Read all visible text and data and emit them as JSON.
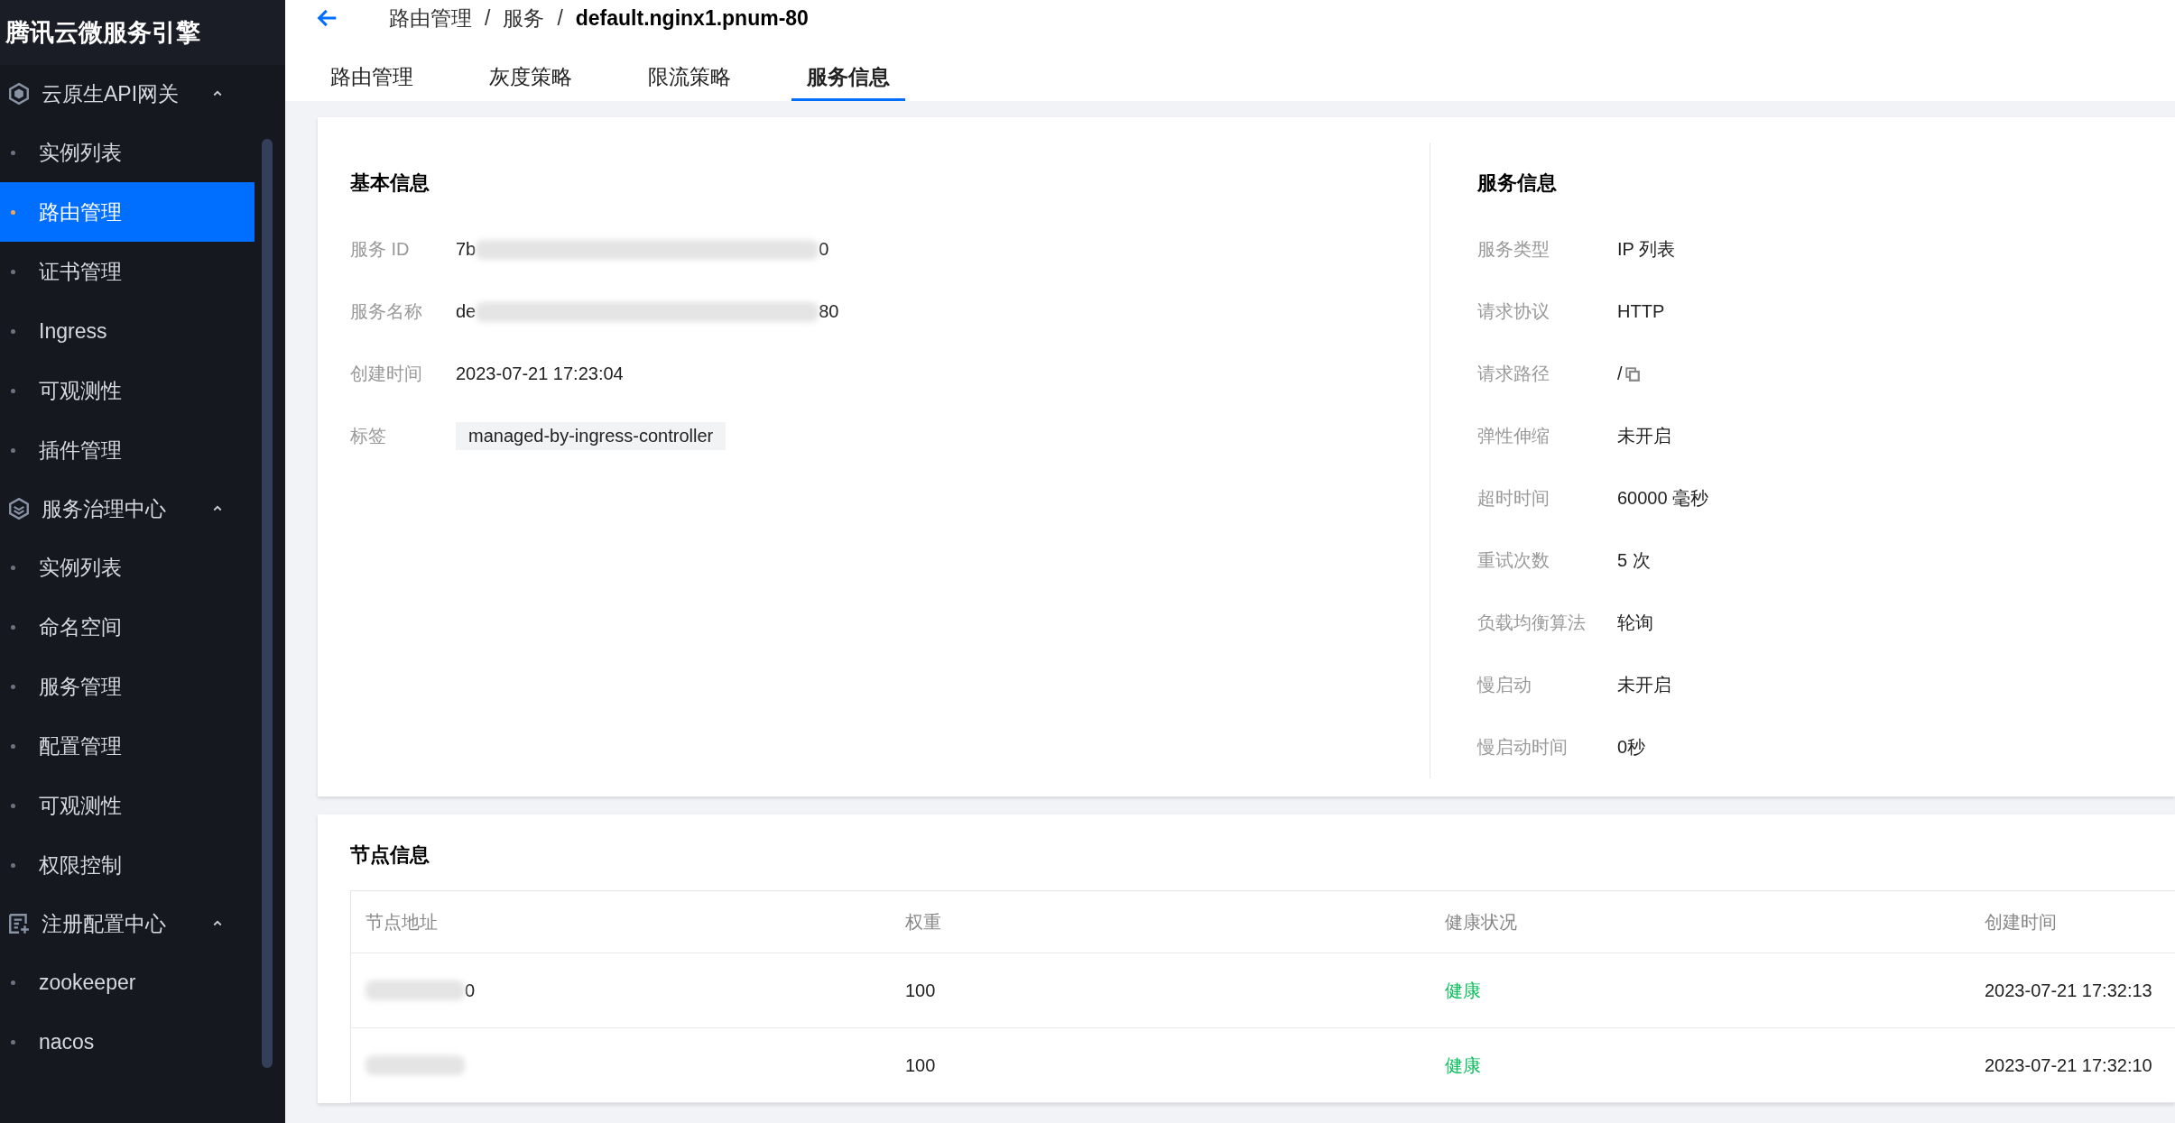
{
  "app": {
    "title": "腾讯云微服务引擎"
  },
  "sidebar": {
    "groups": [
      {
        "kind": "gateway",
        "label": "云原生API网关",
        "expanded": true,
        "items": [
          {
            "label": "实例列表",
            "selected": false
          },
          {
            "label": "路由管理",
            "selected": true
          },
          {
            "label": "证书管理",
            "selected": false
          },
          {
            "label": "Ingress",
            "selected": false
          },
          {
            "label": "可观测性",
            "selected": false
          },
          {
            "label": "插件管理",
            "selected": false
          }
        ]
      },
      {
        "kind": "governance",
        "label": "服务治理中心",
        "expanded": true,
        "items": [
          {
            "label": "实例列表",
            "selected": false
          },
          {
            "label": "命名空间",
            "selected": false
          },
          {
            "label": "服务管理",
            "selected": false
          },
          {
            "label": "配置管理",
            "selected": false
          },
          {
            "label": "可观测性",
            "selected": false
          },
          {
            "label": "权限控制",
            "selected": false
          }
        ]
      },
      {
        "kind": "registry",
        "label": "注册配置中心",
        "expanded": true,
        "items": [
          {
            "label": "zookeeper",
            "selected": false
          },
          {
            "label": "nacos",
            "selected": false
          }
        ]
      }
    ]
  },
  "breadcrumb": [
    "路由管理",
    "/",
    "服务",
    "/",
    "default.nginx1.pnum-80"
  ],
  "tabs": [
    {
      "label": "路由管理",
      "selected": false
    },
    {
      "label": "灰度策略",
      "selected": false
    },
    {
      "label": "限流策略",
      "selected": false
    },
    {
      "label": "服务信息",
      "selected": true
    }
  ],
  "basic_info": {
    "title": "基本信息",
    "fields": [
      {
        "kind": "blurred",
        "label": "服务 ID",
        "prefix": "7b",
        "suffix": "0"
      },
      {
        "kind": "blurred",
        "label": "服务名称",
        "prefix": "de",
        "suffix": "80"
      },
      {
        "kind": "text",
        "label": "创建时间",
        "value": "2023-07-21 17:23:04"
      },
      {
        "kind": "tag",
        "label": "标签",
        "value": "managed-by-ingress-controller"
      }
    ]
  },
  "service_info": {
    "title": "服务信息",
    "fields": [
      {
        "kind": "text",
        "label": "服务类型",
        "value": "IP 列表"
      },
      {
        "kind": "text",
        "label": "请求协议",
        "value": "HTTP"
      },
      {
        "kind": "copy",
        "label": "请求路径",
        "value": "/"
      },
      {
        "kind": "text",
        "label": "弹性伸缩",
        "value": "未开启"
      },
      {
        "kind": "text",
        "label": "超时时间",
        "value": "60000 毫秒"
      },
      {
        "kind": "text",
        "label": "重试次数",
        "value": "5 次"
      },
      {
        "kind": "text",
        "label": "负载均衡算法",
        "value": "轮询"
      },
      {
        "kind": "text",
        "label": "慢启动",
        "value": "未开启"
      },
      {
        "kind": "text",
        "label": "慢启动时间",
        "value": "0秒"
      }
    ]
  },
  "nodes": {
    "title": "节点信息",
    "columns": [
      "节点地址",
      "权重",
      "健康状况",
      "创建时间"
    ],
    "rows": [
      {
        "address_suffix": "0",
        "weight": "100",
        "health": "健康",
        "healthy": true,
        "created": "2023-07-21 17:32:13"
      },
      {
        "address_suffix": "",
        "weight": "100",
        "health": "健康",
        "healthy": true,
        "created": "2023-07-21 17:32:10"
      }
    ]
  }
}
